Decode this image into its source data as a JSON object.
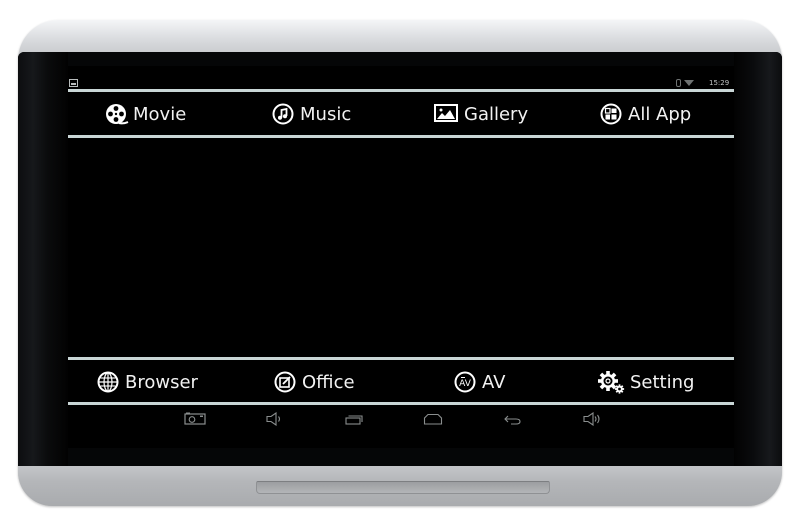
{
  "status_bar": {
    "left_icon": "screenshot-notification-icon",
    "bluetooth_icon": "bluetooth-icon",
    "wifi_icon": "wifi-icon",
    "time": "15:29"
  },
  "top_menu": [
    {
      "label": "Movie",
      "icon": "film-reel-icon"
    },
    {
      "label": "Music",
      "icon": "music-note-icon"
    },
    {
      "label": "Gallery",
      "icon": "picture-icon"
    },
    {
      "label": "All App",
      "icon": "app-grid-icon"
    }
  ],
  "bottom_menu": [
    {
      "label": "Browser",
      "icon": "globe-icon"
    },
    {
      "label": "Office",
      "icon": "edit-document-icon"
    },
    {
      "label": "AV",
      "icon": "av-input-icon"
    },
    {
      "label": "Setting",
      "icon": "gears-icon"
    }
  ],
  "nav_bar": [
    {
      "icon": "camera-screenshot-icon"
    },
    {
      "icon": "volume-down-icon"
    },
    {
      "icon": "recent-apps-icon"
    },
    {
      "icon": "home-icon"
    },
    {
      "icon": "back-icon"
    },
    {
      "icon": "volume-up-icon"
    }
  ],
  "colors": {
    "divider": "#c9d6d6",
    "text": "#f2f2f2",
    "screen": "#000000",
    "bezel": "#c9cbce"
  }
}
